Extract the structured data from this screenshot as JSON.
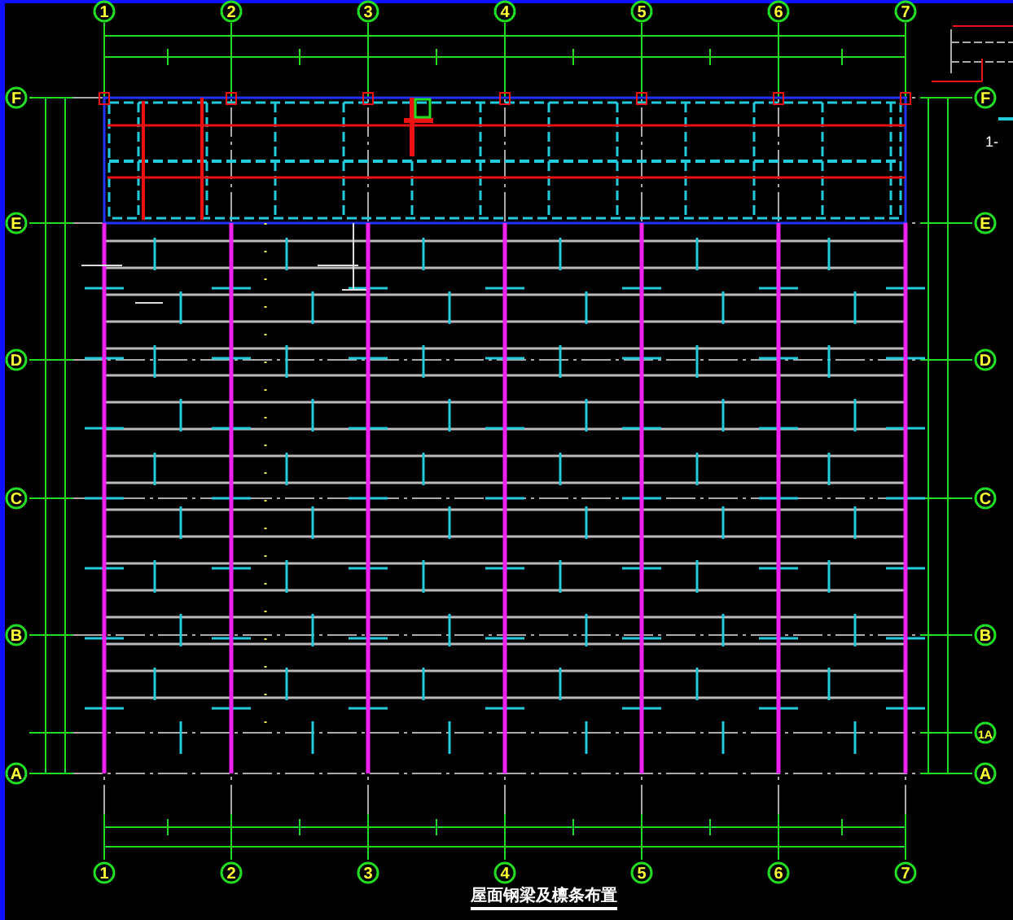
{
  "columns_top": [
    {
      "label": "1"
    },
    {
      "label": "2"
    },
    {
      "label": "3"
    },
    {
      "label": "4"
    },
    {
      "label": "5"
    },
    {
      "label": "6"
    },
    {
      "label": "7"
    }
  ],
  "columns_bottom": [
    {
      "label": "1"
    },
    {
      "label": "2"
    },
    {
      "label": "3"
    },
    {
      "label": "4"
    },
    {
      "label": "5"
    },
    {
      "label": "6"
    },
    {
      "label": "7"
    }
  ],
  "rows_left": [
    {
      "label": "F"
    },
    {
      "label": "E"
    },
    {
      "label": "D"
    },
    {
      "label": "C"
    },
    {
      "label": "B"
    },
    {
      "label": "A"
    }
  ],
  "rows_right": [
    {
      "label": "F"
    },
    {
      "label": "E"
    },
    {
      "label": "D"
    },
    {
      "label": "C"
    },
    {
      "label": "B"
    },
    {
      "label": "1A"
    },
    {
      "label": "A"
    }
  ],
  "side_note": "1-",
  "drawing_title": "屋面钢梁及檩条布置"
}
